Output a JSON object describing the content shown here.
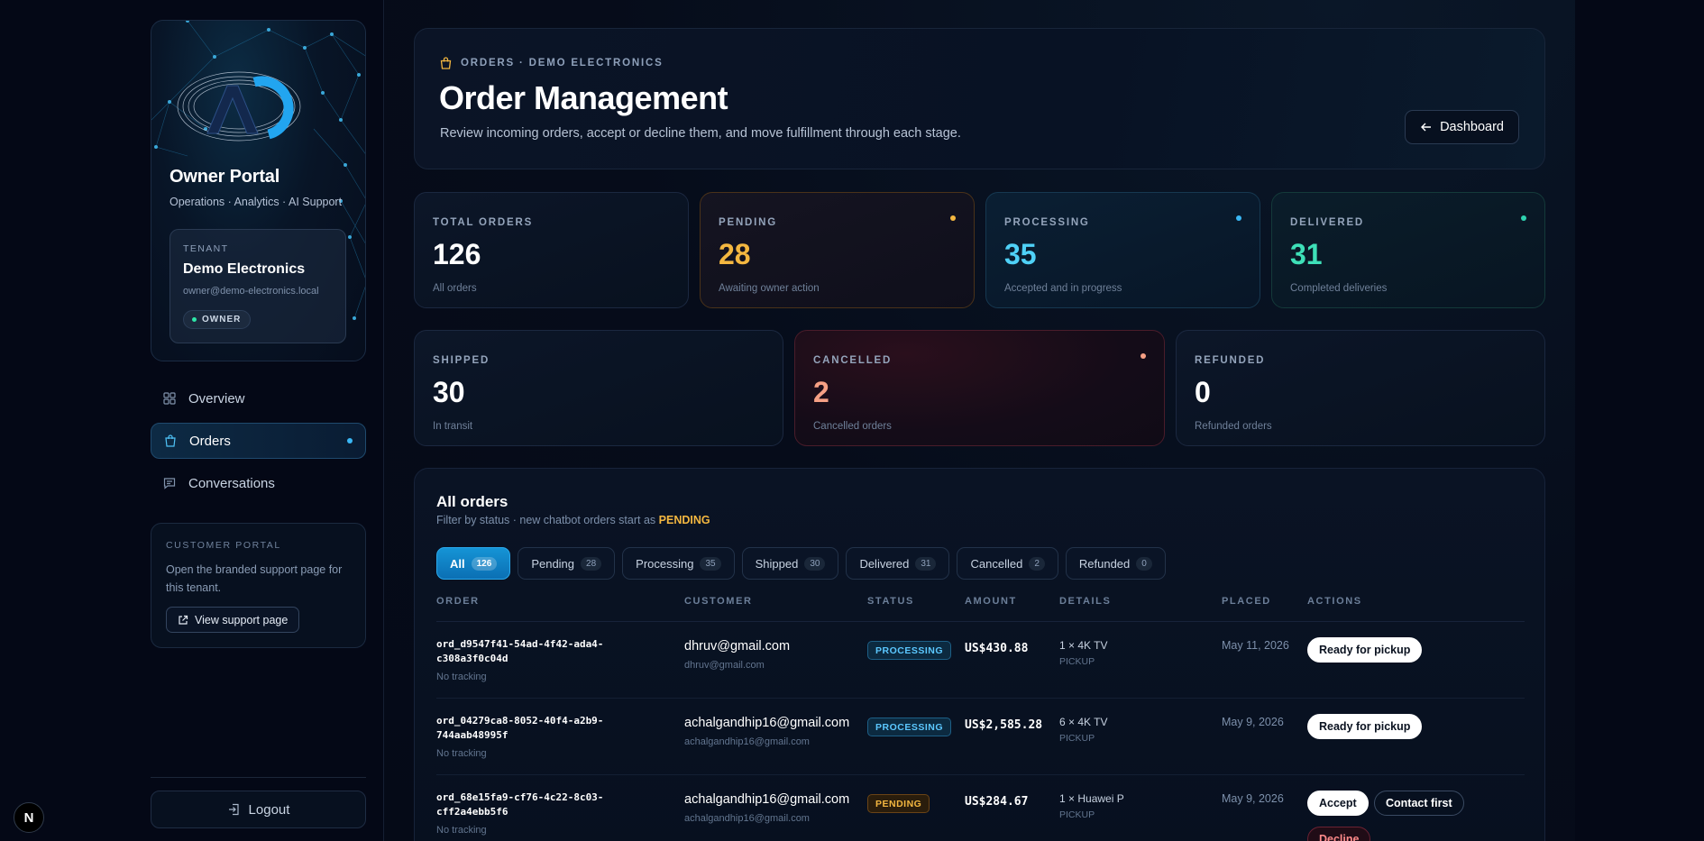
{
  "sidebar": {
    "portal_title": "Owner Portal",
    "portal_subtitle": "Operations · Analytics · AI Support",
    "tenant": {
      "label": "TENANT",
      "name": "Demo Electronics",
      "email": "owner@demo-electronics.local",
      "role": "OWNER"
    },
    "nav": [
      {
        "label": "Overview",
        "icon": "grid-icon"
      },
      {
        "label": "Orders",
        "icon": "shopping-bag-icon",
        "active": true
      },
      {
        "label": "Conversations",
        "icon": "chat-icon"
      }
    ],
    "customer_portal": {
      "label": "CUSTOMER PORTAL",
      "text": "Open the branded support page for this tenant.",
      "button": "View support page"
    },
    "logout": "Logout",
    "dev_badge": "N"
  },
  "header": {
    "breadcrumb": "ORDERS · DEMO ELECTRONICS",
    "title": "Order Management",
    "description": "Review incoming orders, accept or decline them, and move fulfillment through each stage.",
    "dashboard_button": "Dashboard"
  },
  "stats": [
    {
      "label": "TOTAL ORDERS",
      "value": "126",
      "sub": "All orders"
    },
    {
      "label": "PENDING",
      "value": "28",
      "sub": "Awaiting owner action"
    },
    {
      "label": "PROCESSING",
      "value": "35",
      "sub": "Accepted and in progress"
    },
    {
      "label": "DELIVERED",
      "value": "31",
      "sub": "Completed deliveries"
    },
    {
      "label": "SHIPPED",
      "value": "30",
      "sub": "In transit"
    },
    {
      "label": "CANCELLED",
      "value": "2",
      "sub": "Cancelled orders"
    },
    {
      "label": "REFUNDED",
      "value": "0",
      "sub": "Refunded orders"
    }
  ],
  "colors": {
    "pending": "#f4b740",
    "processing": "#4fc3f7",
    "delivered": "#3ee0b8",
    "cancelled": "#f6a085",
    "accent": "#1594d6"
  },
  "orders": {
    "title": "All orders",
    "subtitle_prefix": "Filter by status · new chatbot orders start as",
    "subtitle_highlight": "PENDING",
    "filters": [
      {
        "label": "All",
        "count": "126",
        "active": true
      },
      {
        "label": "Pending",
        "count": "28"
      },
      {
        "label": "Processing",
        "count": "35"
      },
      {
        "label": "Shipped",
        "count": "30"
      },
      {
        "label": "Delivered",
        "count": "31"
      },
      {
        "label": "Cancelled",
        "count": "2"
      },
      {
        "label": "Refunded",
        "count": "0"
      }
    ],
    "columns": [
      "ORDER",
      "CUSTOMER",
      "STATUS",
      "AMOUNT",
      "DETAILS",
      "PLACED",
      "ACTIONS"
    ],
    "rows": [
      {
        "id_line1": "ord_d9547f41-54ad-4f42-ada4-",
        "id_line2": "c308a3f0c04d",
        "tracking": "No tracking",
        "customer": "dhruv@gmail.com",
        "customer_email": "dhruv@gmail.com",
        "status": "PROCESSING",
        "amount": "US$430.88",
        "details": "1 × 4K TV",
        "fulfillment": "PICKUP",
        "placed": "May 11, 2026",
        "actions": [
          "Ready for pickup"
        ]
      },
      {
        "id_line1": "ord_04279ca8-8052-40f4-a2b9-",
        "id_line2": "744aab48995f",
        "tracking": "No tracking",
        "customer": "achalgandhip16@gmail.com",
        "customer_email": "achalgandhip16@gmail.com",
        "status": "PROCESSING",
        "amount": "US$2,585.28",
        "details": "6 × 4K TV",
        "fulfillment": "PICKUP",
        "placed": "May 9, 2026",
        "actions": [
          "Ready for pickup"
        ]
      },
      {
        "id_line1": "ord_68e15fa9-cf76-4c22-8c03-",
        "id_line2": "cff2a4ebb5f6",
        "tracking": "No tracking",
        "customer": "achalgandhip16@gmail.com",
        "customer_email": "achalgandhip16@gmail.com",
        "status": "PENDING",
        "amount": "US$284.67",
        "details": "1 × Huawei P",
        "fulfillment": "PICKUP",
        "placed": "May 9, 2026",
        "actions": [
          "Accept",
          "Contact first",
          "Decline"
        ]
      }
    ]
  }
}
